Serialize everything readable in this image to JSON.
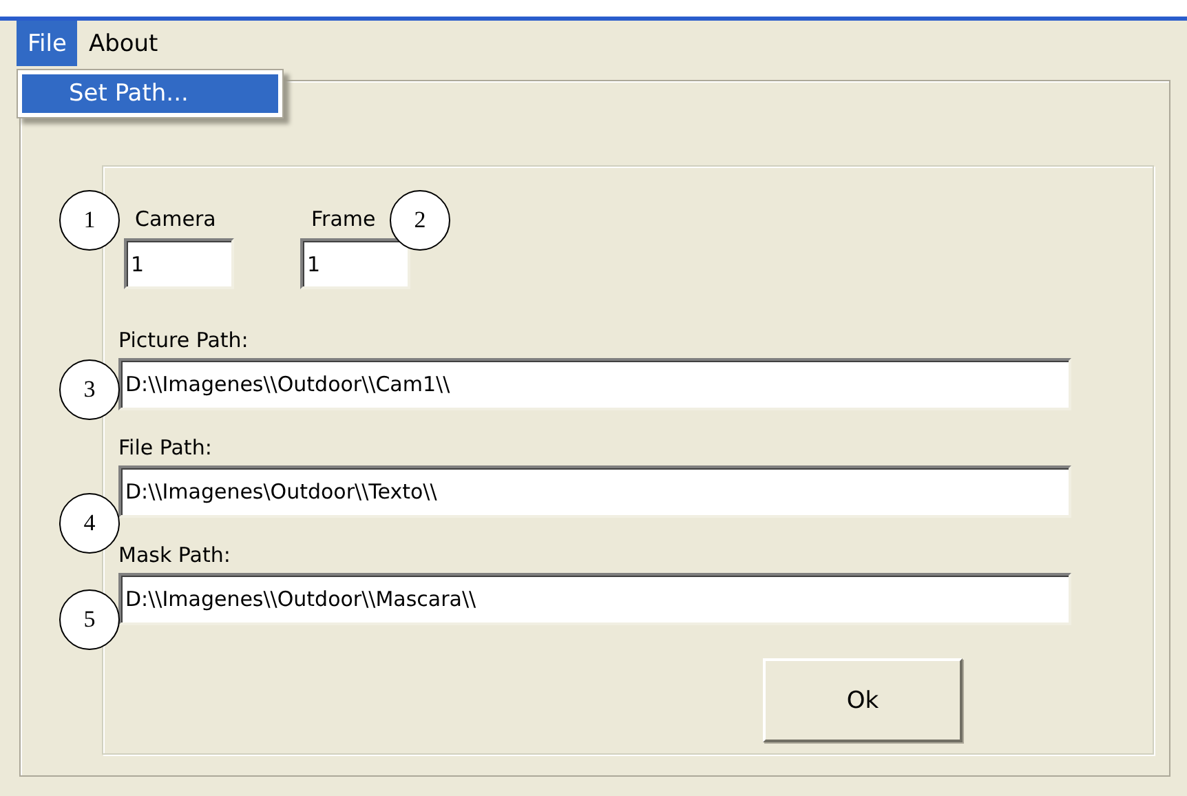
{
  "menu": [
    {
      "label": "File",
      "selected": true
    },
    {
      "label": "About",
      "selected": false
    }
  ],
  "dropdown": {
    "items": [
      {
        "label": "Set Path...",
        "selected": true
      }
    ]
  },
  "small_fields": [
    {
      "label": "Camera",
      "value": "1"
    },
    {
      "label": "Frame",
      "value": "1"
    }
  ],
  "path_fields": [
    {
      "label": "Picture Path:",
      "value": "D:\\\\Imagenes\\\\Outdoor\\\\Cam1\\\\"
    },
    {
      "label": "File Path:",
      "value": "D:\\\\Imagenes\\Outdoor\\\\Texto\\\\"
    },
    {
      "label": "Mask Path:",
      "value": "D:\\\\Imagenes\\\\Outdoor\\\\Mascara\\\\"
    }
  ],
  "button": "Ok",
  "annotations": [
    "1",
    "2",
    "3",
    "4",
    "5"
  ]
}
